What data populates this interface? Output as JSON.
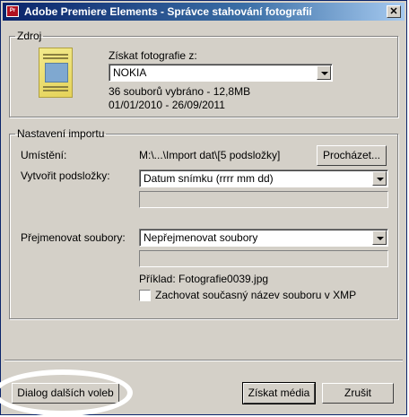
{
  "window": {
    "title": "Adobe Premiere Elements - Správce stahování fotografií",
    "app_icon": "Pr",
    "close_glyph": "✕"
  },
  "source": {
    "legend": "Zdroj",
    "get_photos_label": "Získat fotografie z:",
    "device_value": "NOKIA",
    "selection_summary": "36 souborů vybráno - 12,8MB",
    "date_range": "01/01/2010 - 26/09/2011"
  },
  "import": {
    "legend": "Nastavení importu",
    "location_label": "Umístění:",
    "location_value": "M:\\...\\Import dat\\[5 podsložky]",
    "browse_button": "Procházet...",
    "subfolders_label": "Vytvořit podsložky:",
    "subfolders_value": "Datum snímku (rrrr mm dd)",
    "rename_label": "Přejmenovat soubory:",
    "rename_value": "Nepřejmenovat soubory",
    "example_label": "Příklad:",
    "example_value": "Fotografie0039.jpg",
    "keep_name_label": "Zachovat současný název souboru v XMP",
    "keep_name_checked": false
  },
  "footer": {
    "advanced_button": "Dialog dalších voleb",
    "get_media_button": "Získat média",
    "cancel_button": "Zrušit"
  }
}
